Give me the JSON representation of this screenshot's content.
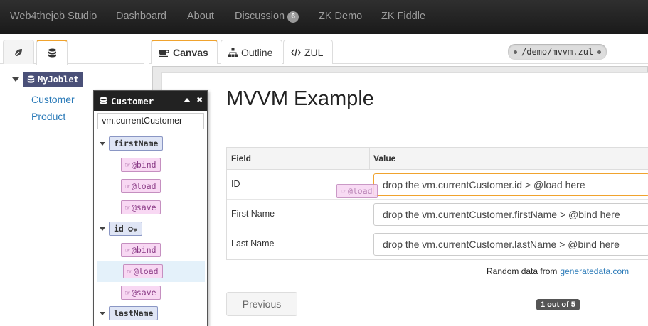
{
  "nav": {
    "brand": "Web4thejob Studio",
    "items": [
      "Dashboard",
      "About",
      "Discussion",
      "ZK Demo",
      "ZK Fiddle"
    ],
    "discussion_badge": "6"
  },
  "left_panel": {
    "tab_icons": [
      "leaf-icon",
      "database-icon"
    ],
    "active_tab": 1,
    "tree": {
      "root": "MyJoblet",
      "children": [
        "Customer",
        "Product"
      ]
    }
  },
  "customer_panel": {
    "title": "Customer",
    "input_value": "vm.currentCustomer",
    "properties": [
      {
        "name": "firstName",
        "annotations": [
          "@bind",
          "@load",
          "@save"
        ]
      },
      {
        "name": "id",
        "key_icon": true,
        "annotations": [
          "@bind",
          "@load",
          "@save"
        ]
      },
      {
        "name": "lastName",
        "annotations": []
      }
    ],
    "highlighted": "@load"
  },
  "main": {
    "tabs": [
      "Canvas",
      "Outline",
      "ZUL"
    ],
    "active_tab": "Canvas",
    "path": "/demo/mvvm.zul",
    "page_title": "MVVM Example",
    "grid": {
      "headers": [
        "Field",
        "Value"
      ],
      "rows": [
        {
          "label": "ID",
          "value": "drop the vm.currentCustomer.id > @load here"
        },
        {
          "label": "First Name",
          "value": "drop the vm.currentCustomer.firstName > @bind here"
        },
        {
          "label": "Last Name",
          "value": "drop the vm.currentCustomer.lastName > @bind here"
        }
      ]
    },
    "drag_ghost": "@load",
    "random_note": "Random data from",
    "random_link": "generatedata.com",
    "prev_button": "Previous",
    "page_badge": "1 out of 5"
  },
  "colors": {
    "accent": "#f0a32e",
    "root_pill": "#4a5078",
    "annotation_bg": "#f8d8f3",
    "property_bg": "#dfe5f5",
    "link": "#2a7ab8"
  }
}
